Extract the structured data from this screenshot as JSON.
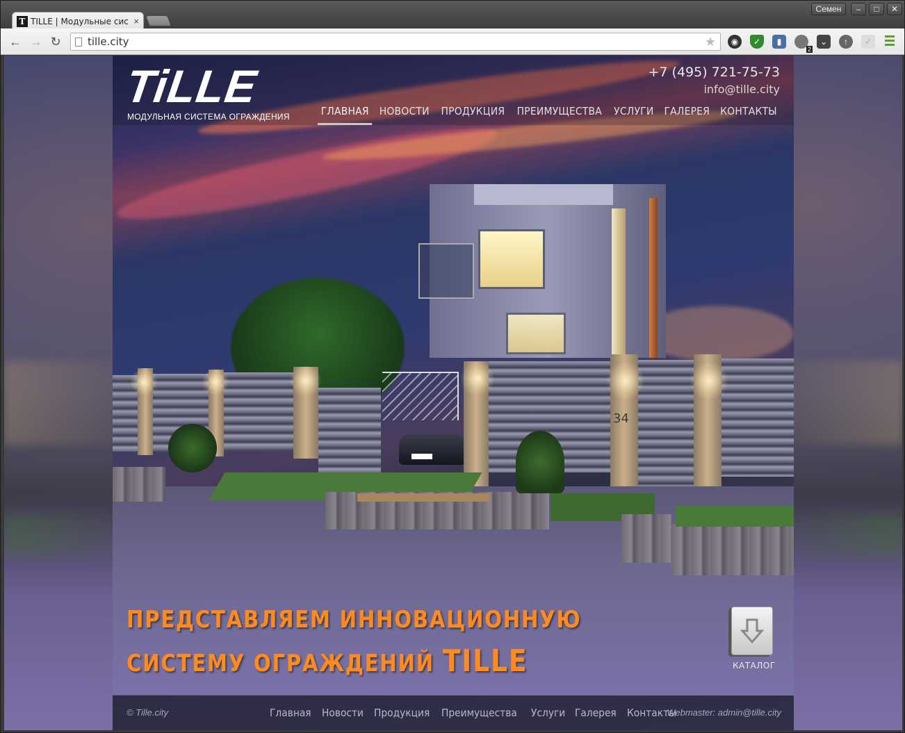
{
  "browser": {
    "tab_title": "TILLE | Модульные сис",
    "tab_close": "×",
    "user_name": "Семен",
    "url": "tille.city",
    "window_buttons": [
      "–",
      "□",
      "✕"
    ],
    "extension_badge": "2"
  },
  "site": {
    "logo_text": "TiLLE",
    "logo_subtitle": "МОДУЛЬНАЯ СИСТЕМА ОГРАЖДЕНИЯ",
    "phone": "+7 (495) 721-75-73",
    "email": "info@tille.city",
    "menu": [
      {
        "label": "ГЛАВНАЯ",
        "active": true
      },
      {
        "label": "НОВОСТИ",
        "active": false
      },
      {
        "label": "ПРОДУКЦИЯ",
        "active": false
      },
      {
        "label": "ПРЕИМУЩЕСТВА",
        "active": false
      },
      {
        "label": "УСЛУГИ",
        "active": false
      },
      {
        "label": "ГАЛЕРЕЯ",
        "active": false
      },
      {
        "label": "КОНТАКТЫ",
        "active": false
      }
    ],
    "house_number": "34",
    "headline_line1": "ПРЕДСТАВЛЯЕМ ИННОВАЦИОННУЮ",
    "headline_line2a": "СИСТЕМУ ОГРАЖДЕНИЙ ",
    "headline_line2b": "TILLE",
    "catalog_label": "КАТАЛОГ",
    "footer": {
      "copyright": "© Tille.city",
      "links": [
        "Главная",
        "Новости",
        "Продукция",
        "Преимущества",
        "Услуги",
        "Галерея",
        "Контакты"
      ],
      "webmaster": "Webmaster: admin@tille.city"
    }
  },
  "colors": {
    "headline": "#ff8a1e",
    "footer_bg": "#28283e"
  }
}
